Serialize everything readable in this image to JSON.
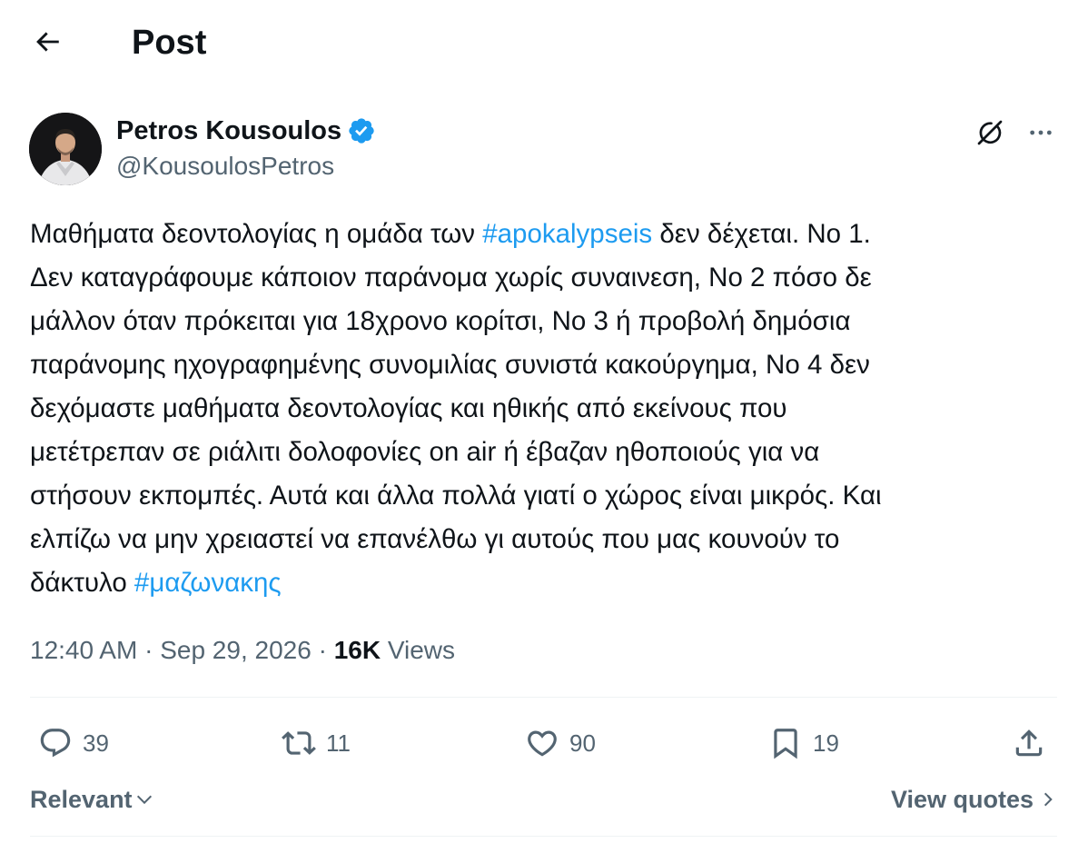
{
  "header": {
    "title": "Post"
  },
  "author": {
    "name": "Petros Kousoulos",
    "handle": "@KousoulosPetros",
    "verified": true
  },
  "tweet": {
    "lines": [
      [
        "Μαθήματα δεοντολογίας η ομάδα των ",
        "#apokalypseis",
        " δεν δέχεται. Νο 1."
      ],
      [
        "Δεν καταγράφουμε κάποιον παράνομα χωρίς συναινεση, Νο 2 πόσο δε"
      ],
      [
        "μάλλον όταν πρόκειται για 18χρονο κορίτσι, Νο 3 ή προβολή δημόσια"
      ],
      [
        "παράνομης ηχογραφημένης συνομιλίας συνιστά κακούργημα, Νο 4 δεν"
      ],
      [
        "δεχόμαστε μαθήματα δεοντολογίας και ηθικής από εκείνους που"
      ],
      [
        "μετέτρεπαν σε ριάλιτι δολοφονίες on air ή έβαζαν ηθοποιούς για να"
      ],
      [
        "στήσουν εκπομπές. Αυτά και άλλα πολλά γιατί ο χώρος είναι μικρός. Και"
      ],
      [
        "ελπίζω να μην χρειαστεί να επανέλθω γι αυτούς που μας κουνούν το"
      ],
      [
        "δάκτυλο ",
        "#μαζωνακης"
      ]
    ],
    "line_1_pre": "Μαθήματα δεοντολογίας η ομάδα των ",
    "hashtag_1": "#apokalypseis",
    "line_1_post": " δεν δέχεται. Νο 1.",
    "line_2": "Δεν καταγράφουμε κάποιον παράνομα χωρίς συναινεση, Νο 2 πόσο δε",
    "line_3": "μάλλον όταν πρόκειται για 18χρονο κορίτσι, Νο 3 ή προβολή δημόσια",
    "line_4": "παράνομης ηχογραφημένης συνομιλίας συνιστά κακούργημα, Νο 4 δεν",
    "line_5": "δεχόμαστε μαθήματα δεοντολογίας και ηθικής από εκείνους που",
    "line_6": "μετέτρεπαν σε ριάλιτι δολοφονίες on air ή έβαζαν ηθοποιούς για να",
    "line_7": "στήσουν εκπομπές. Αυτά και άλλα πολλά γιατί ο χώρος είναι μικρός. Και",
    "line_8": "ελπίζω να μην χρειαστεί να επανέλθω γι αυτούς που μας κουνούν το",
    "line_9_pre": "δάκτυλο ",
    "hashtag_2": "#μαζωνακης"
  },
  "meta": {
    "time": "12:40 AM",
    "separator": " · ",
    "date": "Sep 29, 2026",
    "views_count": "16K",
    "views_label": " Views"
  },
  "actions": {
    "replies": "39",
    "reposts": "11",
    "likes": "90",
    "bookmarks": "19"
  },
  "footer": {
    "sort_label": "Relevant",
    "view_quotes_label": "View quotes"
  },
  "colors": {
    "text": "#0f1419",
    "secondary": "#536471",
    "accent": "#1d9bf0",
    "divider": "#eff3f4"
  },
  "icons": {
    "back": "arrow-left-icon",
    "verified": "verified-badge-icon",
    "grok": "grok-icon",
    "more": "more-icon",
    "reply": "reply-icon",
    "repost": "repost-icon",
    "like": "heart-icon",
    "bookmark": "bookmark-icon",
    "share": "share-icon"
  }
}
